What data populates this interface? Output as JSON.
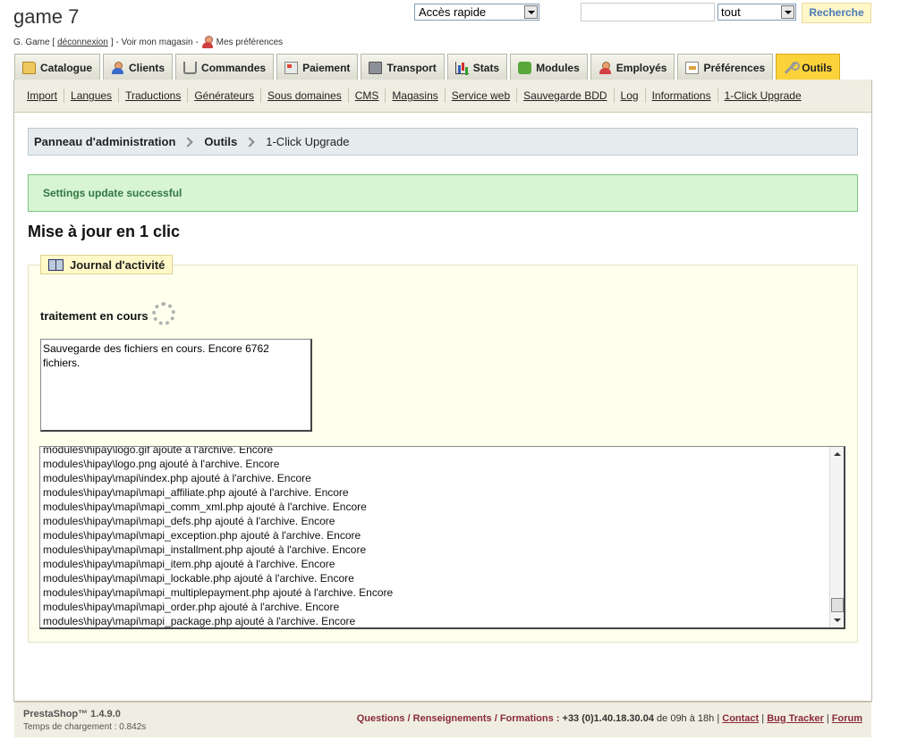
{
  "header": {
    "shop_name": "game 7",
    "user_name": "G. Game [",
    "logout_label": "déconnexion",
    "view_store": "] - Voir mon magasin -",
    "my_preferences": "Mes préférences",
    "quick_access": "Accès rapide",
    "search_value": "",
    "search_scope": "tout",
    "search_button": "Recherche"
  },
  "tabs": [
    {
      "label": "Catalogue",
      "icon": "folder-icon"
    },
    {
      "label": "Clients",
      "icon": "person-icon"
    },
    {
      "label": "Commandes",
      "icon": "cart-icon"
    },
    {
      "label": "Paiement",
      "icon": "card-icon"
    },
    {
      "label": "Transport",
      "icon": "truck-icon"
    },
    {
      "label": "Stats",
      "icon": "chart-icon"
    },
    {
      "label": "Modules",
      "icon": "puzzle-icon"
    },
    {
      "label": "Employés",
      "icon": "person-icon"
    },
    {
      "label": "Préférences",
      "icon": "prefs-icon"
    },
    {
      "label": "Outils",
      "icon": "wrench-icon",
      "active": true
    }
  ],
  "subnav": [
    "Import",
    "Langues",
    "Traductions",
    "Générateurs",
    "Sous domaines",
    "CMS",
    "Magasins",
    "Service web",
    "Sauvegarde BDD",
    "Log",
    "Informations",
    "1-Click Upgrade"
  ],
  "breadcrumb": [
    "Panneau d'administration",
    "Outils",
    "1-Click Upgrade"
  ],
  "success_message": "Settings update successful",
  "page_title": "Mise à jour en 1 clic",
  "activity": {
    "legend": "Journal d'activité",
    "processing": "traitement en cours",
    "status_text": "Sauvegarde des fichiers en cours. Encore 6762 fichiers.",
    "log": [
      "modules\\hipay\\logo.gif ajouté à l'archive. Encore",
      "modules\\hipay\\logo.png ajouté à l'archive. Encore",
      "modules\\hipay\\mapi\\index.php ajouté à l'archive. Encore",
      "modules\\hipay\\mapi\\mapi_affiliate.php ajouté à l'archive. Encore",
      "modules\\hipay\\mapi\\mapi_comm_xml.php ajouté à l'archive. Encore",
      "modules\\hipay\\mapi\\mapi_defs.php ajouté à l'archive. Encore",
      "modules\\hipay\\mapi\\mapi_exception.php ajouté à l'archive. Encore",
      "modules\\hipay\\mapi\\mapi_installment.php ajouté à l'archive. Encore",
      "modules\\hipay\\mapi\\mapi_item.php ajouté à l'archive. Encore",
      "modules\\hipay\\mapi\\mapi_lockable.php ajouté à l'archive. Encore",
      "modules\\hipay\\mapi\\mapi_multiplepayment.php ajouté à l'archive. Encore",
      "modules\\hipay\\mapi\\mapi_order.php ajouté à l'archive. Encore",
      "modules\\hipay\\mapi\\mapi_package.php ajouté à l'archive. Encore"
    ]
  },
  "footer": {
    "version": "PrestaShop™ 1.4.9.0",
    "load_time": "Temps de chargement : 0.842s",
    "questions": "Questions / Renseignements / Formations :",
    "phone": "+33 (0)1.40.18.30.04",
    "hours": "de 09h à 18h |",
    "contact": "Contact",
    "bug_tracker": "Bug Tracker",
    "forum": "Forum"
  }
}
